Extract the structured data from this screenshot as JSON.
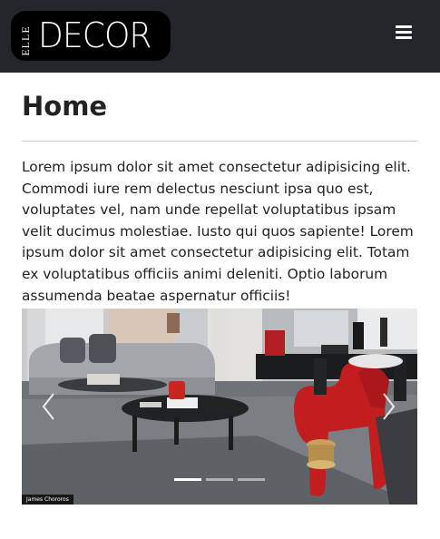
{
  "brand": {
    "elle": "ELLE",
    "decor": "DECOR"
  },
  "nav": {
    "menu_icon": "hamburger-menu-icon"
  },
  "page": {
    "title": "Home",
    "body": "Lorem ipsum dolor sit amet consectetur adipisicing elit. Commodi iure rem delectus nesciunt ipsa quo est, voluptates vel, nam unde repellat voluptatibus ipsam velit ducimus molestiae. Iusto qui quos sapiente! Lorem ipsum dolor sit amet consectetur adipisicing elit. Totam ex voluptatibus officiis animi deleniti. Optio laborum assumenda beatae aspernatur officiis!"
  },
  "carousel": {
    "photo_credit": "James Chororos",
    "slide_count": 3,
    "active_slide": 1,
    "prev_icon": "chevron-left-icon",
    "next_icon": "chevron-right-icon"
  },
  "colors": {
    "navbar_bg": "#23262b",
    "accent_red": "#c21d1f"
  }
}
